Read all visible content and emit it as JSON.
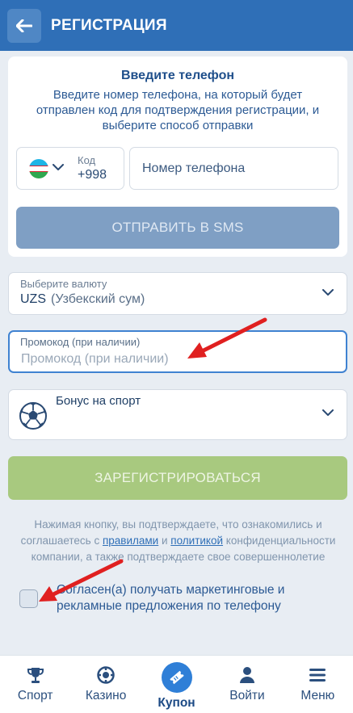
{
  "header": {
    "title": "РЕГИСТРАЦИЯ"
  },
  "phone_card": {
    "title": "Введите телефон",
    "description": "Введите номер телефона, на который будет отправлен код для подтверждения регистрации, и выберите способ отправки",
    "code_label": "Код",
    "code_value": "+998",
    "phone_placeholder": "Номер телефона",
    "send_button": "ОТПРАВИТЬ В SMS"
  },
  "currency": {
    "label": "Выберите валюту",
    "code": "UZS",
    "name": "(Узбекский сум)"
  },
  "promo": {
    "label": "Промокод (при наличии)",
    "placeholder": "Промокод (при наличии)"
  },
  "bonus": {
    "label": "Бонус на спорт"
  },
  "register_button": "ЗАРЕГИСТРИРОВАТЬСЯ",
  "legal": {
    "text1": "Нажимая кнопку, вы подтверждаете, что ознакомились и соглашаетесь с ",
    "rules_link": "правилами",
    "text2": " и ",
    "policy_link": "политикой",
    "text3": " конфиденциальности компании, а также подтверждаете свое совершеннолетие"
  },
  "consent": "Согласен(а) получать маркетинговые и рекламные предложения по телефону",
  "nav": [
    {
      "label": "Спорт",
      "icon": "trophy-icon"
    },
    {
      "label": "Казино",
      "icon": "casino-chip-icon"
    },
    {
      "label": "Купон",
      "icon": "ticket-icon"
    },
    {
      "label": "Войти",
      "icon": "user-icon"
    },
    {
      "label": "Меню",
      "icon": "menu-icon"
    }
  ],
  "colors": {
    "header": "#2f6fb7",
    "send_button": "#7f9fc4",
    "register_button": "#a8c97f",
    "annotation_arrow": "#e02020"
  }
}
